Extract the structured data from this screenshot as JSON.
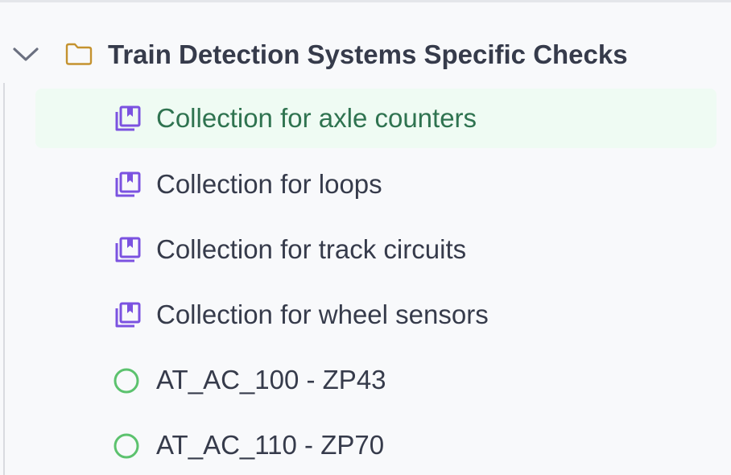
{
  "folder": {
    "label": "Train Detection Systems Specific Checks",
    "expanded": true,
    "icon": "folder-icon",
    "color": "#c4922f"
  },
  "items": [
    {
      "label": "Collection for axle counters",
      "icon": "collection-icon",
      "selected": true
    },
    {
      "label": "Collection for loops",
      "icon": "collection-icon",
      "selected": false
    },
    {
      "label": "Collection for track circuits",
      "icon": "collection-icon",
      "selected": false
    },
    {
      "label": "Collection for wheel sensors",
      "icon": "collection-icon",
      "selected": false
    },
    {
      "label": "AT_AC_100 - ZP43",
      "icon": "circle-outline-icon",
      "selected": false
    },
    {
      "label": "AT_AC_110 - ZP70",
      "icon": "circle-outline-icon",
      "selected": false
    }
  ],
  "colors": {
    "collection_icon": "#7b52e0",
    "circle_icon": "#5cc26e",
    "selected_bg": "#effbf3",
    "selected_text": "#2f7350",
    "text": "#363b4b"
  }
}
